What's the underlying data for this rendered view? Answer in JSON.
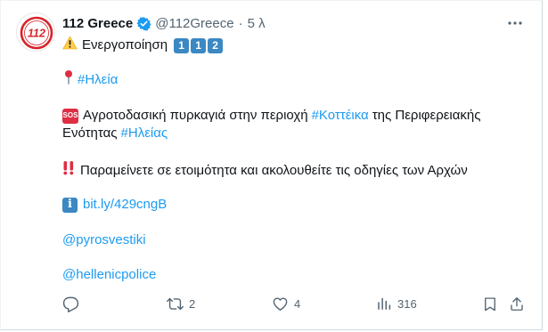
{
  "account": {
    "name": "112 Greece",
    "handle": "@112Greece",
    "separator": "·",
    "time": "5 λ",
    "avatar_text": "112"
  },
  "tweet": {
    "activation_text": "Ενεργοποίηση",
    "location_tag": "#Ηλεία",
    "fire_text_1": "Αγροτοδασική πυρκαγιά στην περιοχή",
    "fire_tag_1": "#Κοττέικα",
    "fire_text_2": "της Περιφερειακής",
    "fire_text_3": "Ενότητας",
    "fire_tag_2": "#Ηλείας",
    "warning_text": "Παραμείνετε σε ετοιμότητα και ακολουθείτε τις οδηγίες των Αρχών",
    "link": "bit.ly/429cngB",
    "mention_1": "@pyrosvestiki",
    "mention_2": "@hellenicpolice",
    "keycaps": [
      "1",
      "1",
      "2"
    ],
    "sos_label": "SOS",
    "info_label": "i"
  },
  "actions": {
    "retweets": "2",
    "likes": "4",
    "views": "316"
  },
  "colors": {
    "link": "#1d9bf0",
    "muted": "#536471",
    "verified": "#1d9bf0",
    "keycap": "#3b88c3",
    "sos": "#dd2e44",
    "avatar_red": "#d8232a"
  },
  "icons": [
    "verified-badge-icon",
    "more-icon",
    "warning-icon",
    "pin-icon",
    "sos-icon",
    "double-exclamation-icon",
    "info-icon",
    "reply-icon",
    "retweet-icon",
    "like-icon",
    "views-icon",
    "bookmark-icon",
    "share-icon"
  ]
}
